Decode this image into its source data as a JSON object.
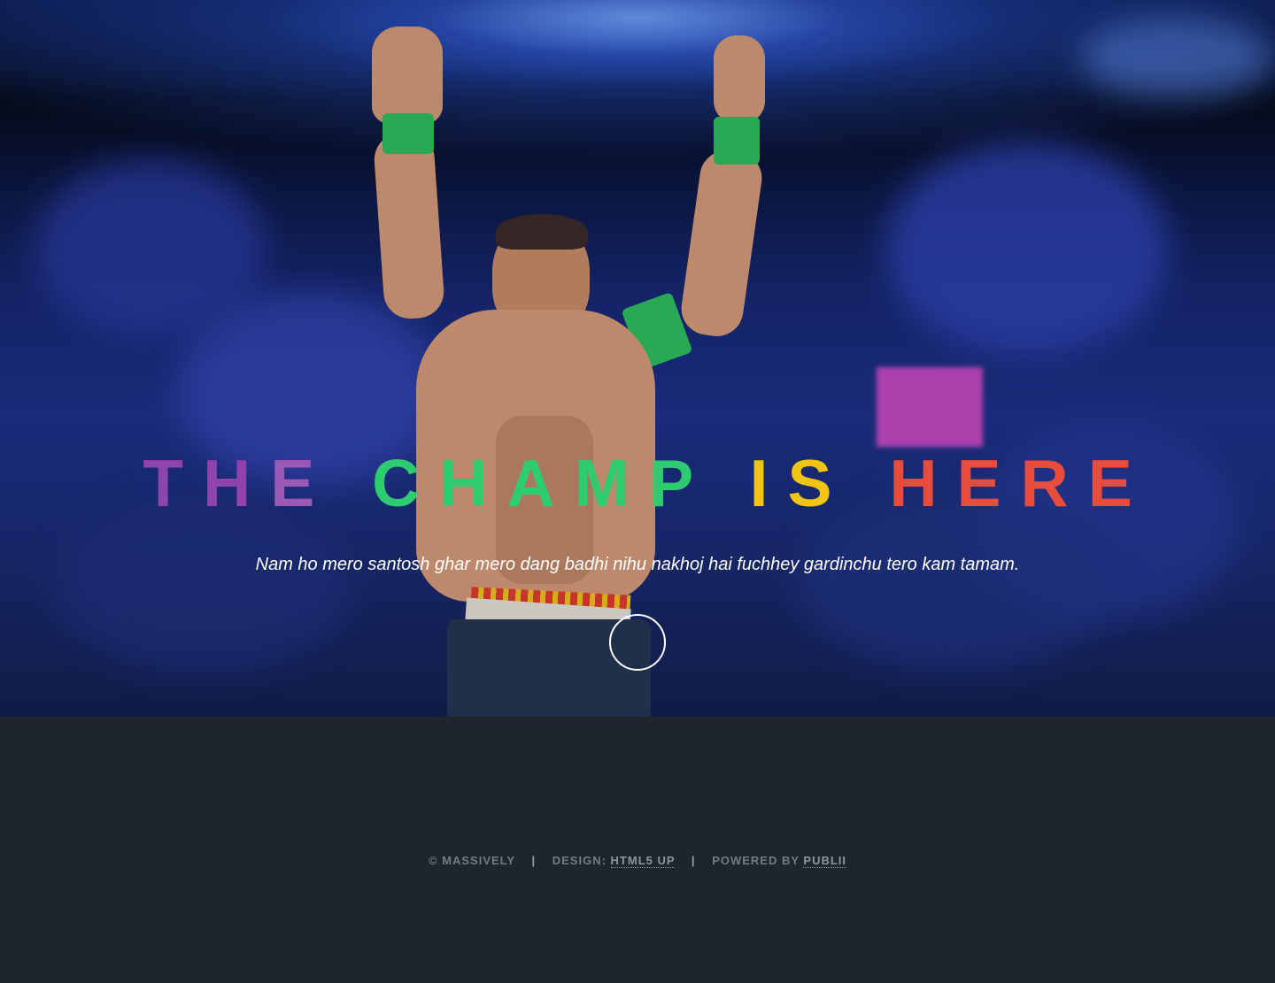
{
  "hero": {
    "title_words": [
      {
        "text": "THE",
        "color_start": "#8e44ad",
        "color_end": "#9b59b6"
      },
      {
        "text": "CHAMP",
        "color": "#2ecc71"
      },
      {
        "text": "IS",
        "color": "#f1c40f"
      },
      {
        "text": "HERE",
        "color": "#e74c3c"
      }
    ],
    "tagline": "Nam ho mero santosh ghar mero dang badhi nihu nakhoj hai fuchhey gardinchu tero kam tamam.",
    "scroll_icon": "chevron-down-icon",
    "scroll_glyph": ""
  },
  "footer": {
    "copyright": "© MASSIVELY",
    "separator": "|",
    "design_prefix": "DESIGN:",
    "design_link": "HTML5 UP",
    "powered_prefix": "POWERED BY",
    "powered_link": "PUBLII"
  },
  "colors": {
    "footer_bg": "#1e252d",
    "footer_text": "#757b82",
    "purple": "#8e44ad",
    "green": "#2ecc71",
    "yellow": "#f1c40f",
    "red": "#e74c3c"
  }
}
